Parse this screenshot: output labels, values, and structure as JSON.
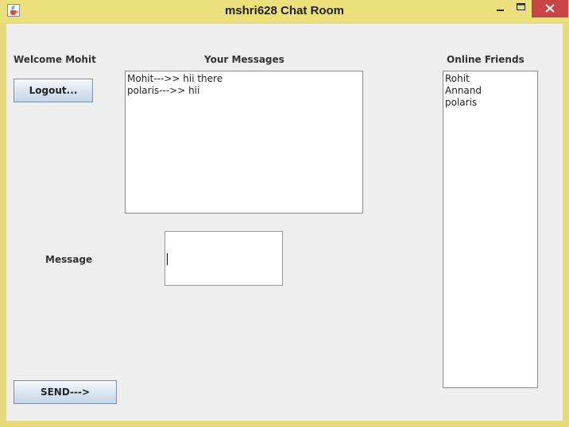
{
  "window": {
    "title": "mshri628 Chat Room",
    "controls": {
      "minimize": "minimize-icon",
      "maximize": "maximize-icon",
      "close": "close-icon"
    },
    "close_color": "#c94545",
    "titlebar_color": "#ece07c"
  },
  "welcome": {
    "text": "Welcome Mohit"
  },
  "logout": {
    "label": "Logout..."
  },
  "messages": {
    "heading": "Your Messages",
    "lines": [
      "Mohit--->> hii there",
      "polaris--->> hii"
    ]
  },
  "friends": {
    "heading": "Online Friends",
    "items": [
      "Rohit",
      "Annand",
      "polaris"
    ]
  },
  "compose": {
    "label": "Message",
    "value": ""
  },
  "send": {
    "label": "SEND--->"
  }
}
